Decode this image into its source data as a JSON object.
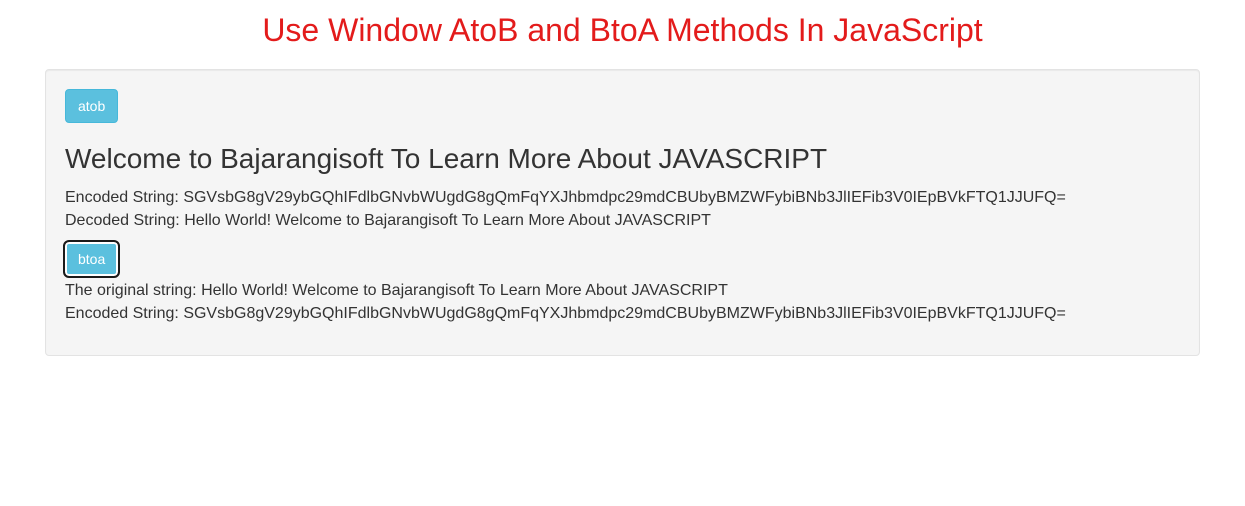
{
  "pageTitle": "Use Window AtoB and BtoA Methods In JavaScript",
  "buttons": {
    "atob": "atob",
    "btoa": "btoa"
  },
  "heading": "Welcome to Bajarangisoft To Learn More About JAVASCRIPT",
  "atobResult": {
    "encodedLabel": "Encoded String:",
    "encodedValue": "SGVsbG8gV29ybGQhIFdlbGNvbWUgdG8gQmFqYXJhbmdpc29mdCBUbyBMZWFybiBNb3JlIEFib3V0IEpBVkFTQ1JJUFQ=",
    "decodedLabel": "Decoded String:",
    "decodedValue": "Hello World! Welcome to Bajarangisoft To Learn More About JAVASCRIPT"
  },
  "btoaResult": {
    "originalLabel": "The original string:",
    "originalValue": "Hello World! Welcome to Bajarangisoft To Learn More About JAVASCRIPT",
    "encodedLabel": "Encoded String:",
    "encodedValue": "SGVsbG8gV29ybGQhIFdlbGNvbWUgdG8gQmFqYXJhbmdpc29mdCBUbyBMZWFybiBNb3JlIEFib3V0IEpBVkFTQ1JJUFQ="
  }
}
